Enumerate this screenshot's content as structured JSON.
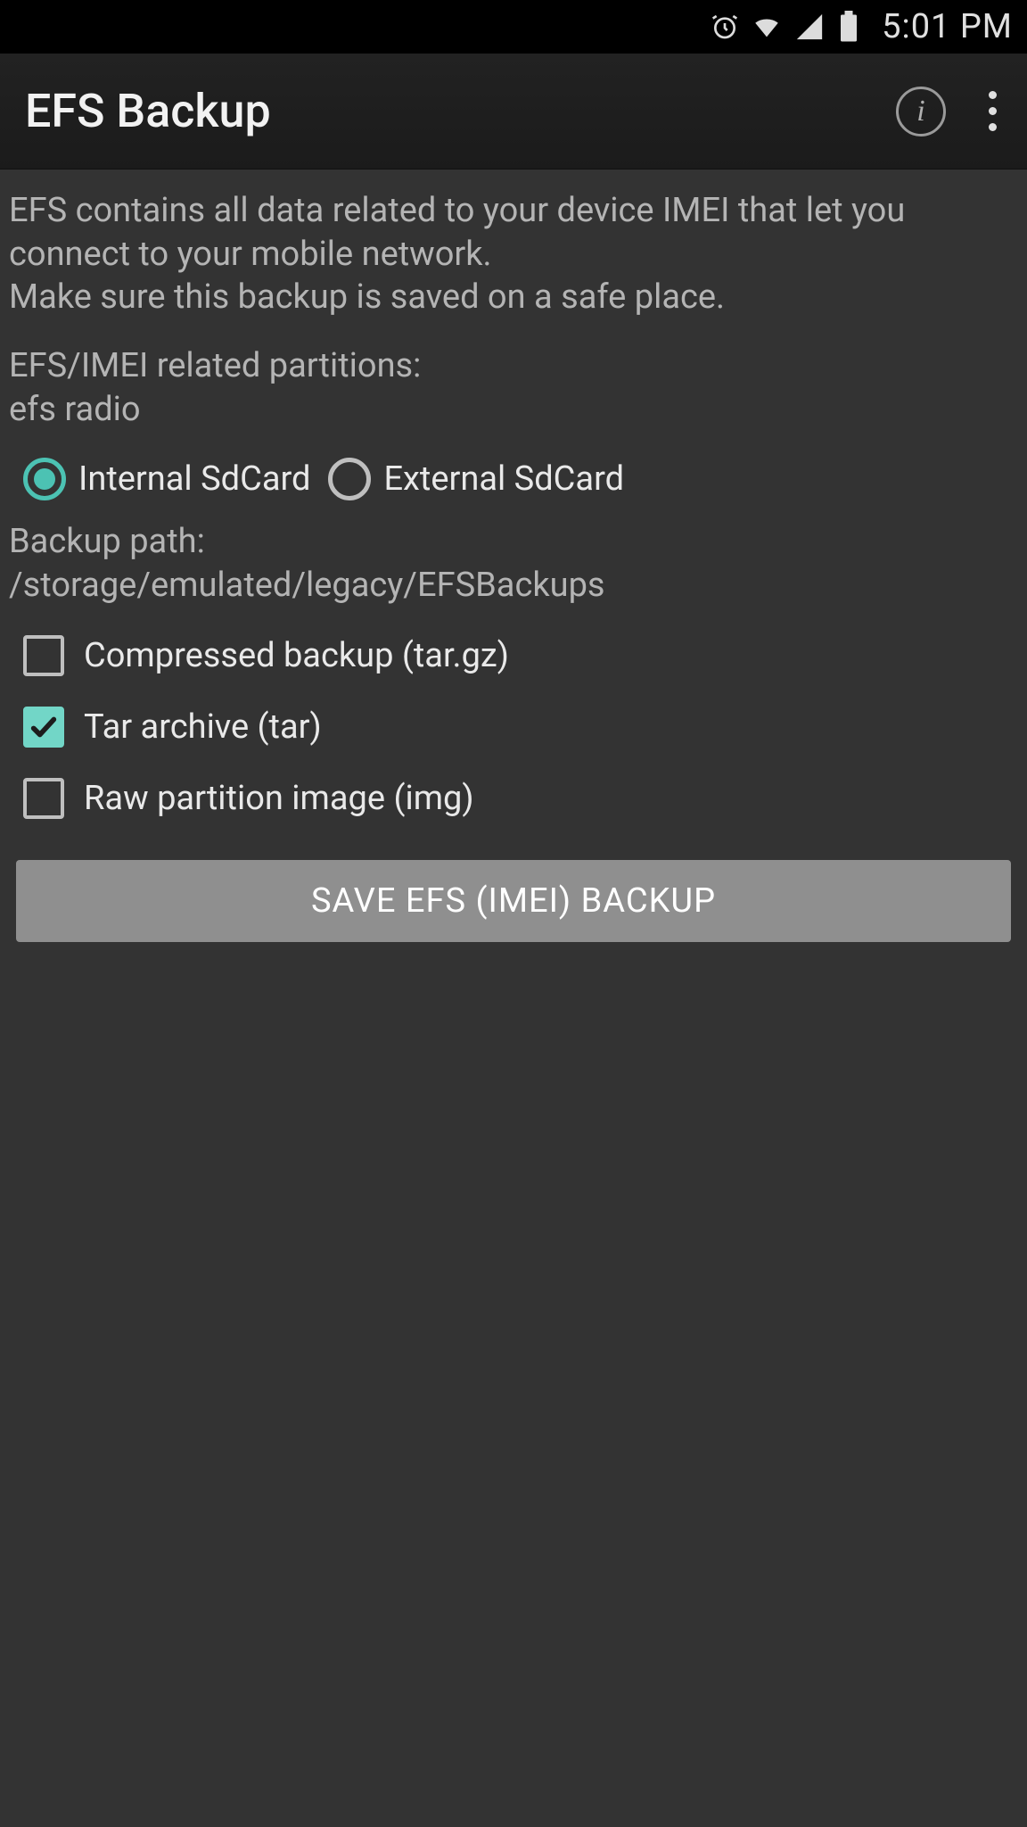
{
  "statusbar": {
    "time": "5:01 PM",
    "icons": {
      "alarm": "alarm",
      "wifi": "wifi",
      "signal": "signal",
      "battery": "battery"
    }
  },
  "actionbar": {
    "title": "EFS Backup",
    "info_label": "i"
  },
  "desc": {
    "line1": "EFS contains all data related to your device IMEI that let you connect to your mobile network.",
    "line2": "Make sure this backup is saved on a safe place."
  },
  "partitions": {
    "header": "EFS/IMEI related partitions:",
    "value": "efs radio"
  },
  "storage": {
    "internal_label": "Internal SdCard",
    "external_label": "External SdCard",
    "selected": "internal"
  },
  "path": {
    "label": "Backup path:",
    "value": "/storage/emulated/legacy/EFSBackups"
  },
  "options": {
    "compressed": {
      "label": "Compressed backup (tar.gz)",
      "checked": false
    },
    "tar": {
      "label": "Tar archive (tar)",
      "checked": true
    },
    "raw": {
      "label": "Raw partition image (img)",
      "checked": false
    }
  },
  "save_button": "SAVE EFS (IMEI) BACKUP"
}
